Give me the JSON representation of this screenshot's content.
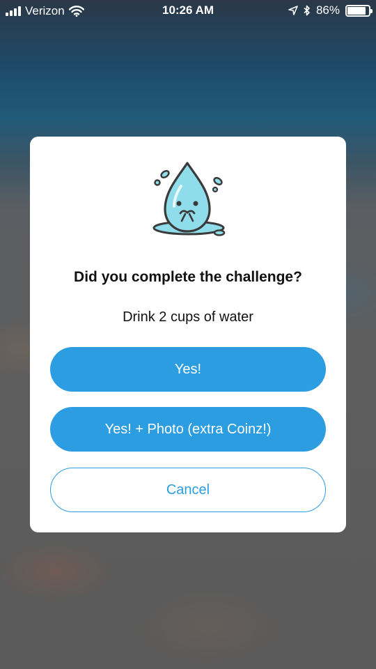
{
  "status_bar": {
    "carrier": "Verizon",
    "time": "10:26 AM",
    "battery": "86%",
    "battery_level": 0.86,
    "icons": [
      "signal-bars-icon",
      "wifi-icon",
      "location-arrow-icon",
      "bluetooth-icon",
      "battery-icon"
    ]
  },
  "dialog": {
    "icon": "water-drop-icon",
    "title": "Did you complete the challenge?",
    "challenge": "Drink 2 cups of water",
    "buttons": {
      "yes": "Yes!",
      "yes_photo": "Yes! + Photo (extra Coinz!)",
      "cancel": "Cancel"
    }
  },
  "colors": {
    "accent": "#2c9de0",
    "drop_fill": "#8fdcea",
    "outline": "#3a3a3a"
  }
}
